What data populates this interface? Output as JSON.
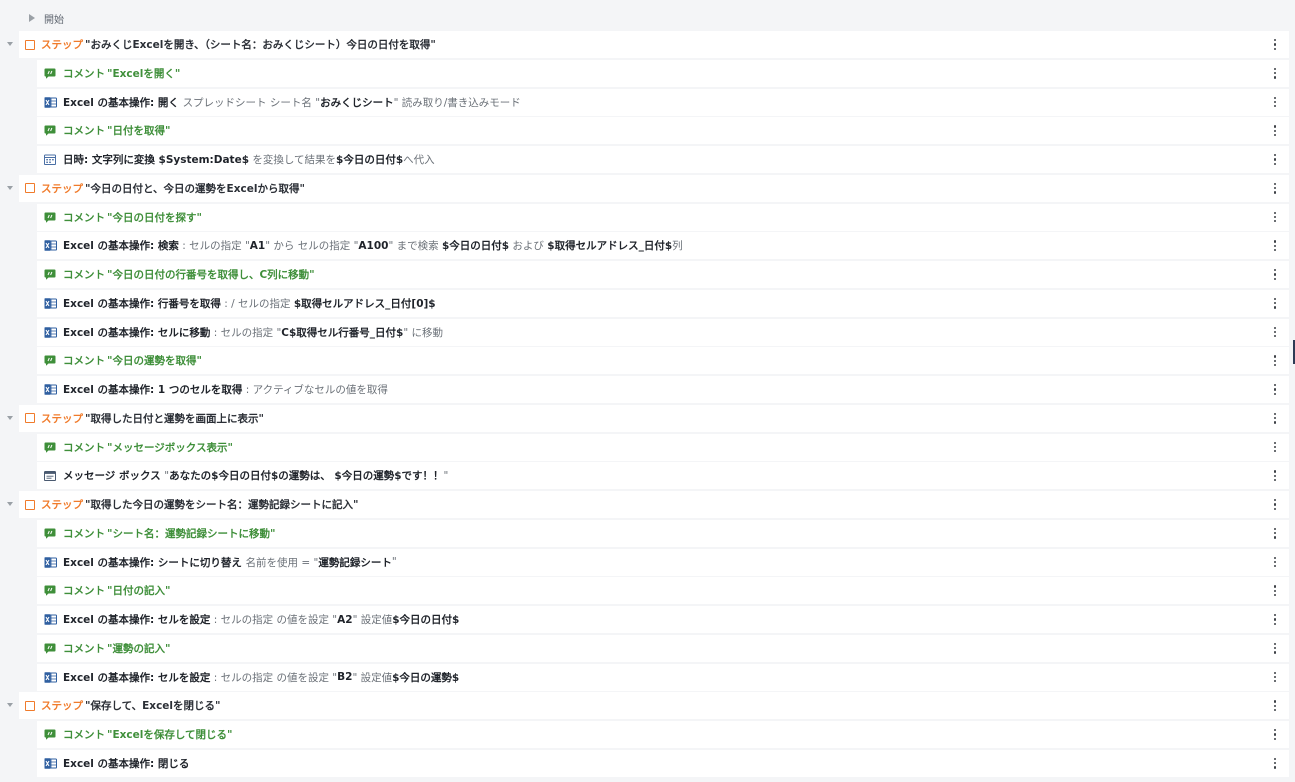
{
  "start_label": "開始",
  "rows": [
    {
      "type": "step",
      "kw": "ステップ",
      "text": "\"おみくじExcelを開き、（シート名：おみくじシート）今日の日付を取得\""
    },
    {
      "type": "comment",
      "kw": "コメント",
      "text": "\"Excelを開く\""
    },
    {
      "type": "excel",
      "parts": [
        [
          "b",
          "Excel の基本操作: 開く "
        ],
        [
          "m",
          "スプレッドシート シート名 \""
        ],
        [
          "s",
          "おみくじシート"
        ],
        [
          "m",
          "\" 読み取り/書き込みモード"
        ]
      ]
    },
    {
      "type": "comment",
      "kw": "コメント",
      "text": "\"日付を取得\""
    },
    {
      "type": "datetime",
      "parts": [
        [
          "b",
          "日時: 文字列に変換 "
        ],
        [
          "s",
          "$System:Date$"
        ],
        [
          "m",
          " を変換して結果を"
        ],
        [
          "s",
          "$今日の日付$"
        ],
        [
          "m",
          "へ代入"
        ]
      ]
    },
    {
      "type": "step",
      "kw": "ステップ",
      "text": "\"今日の日付と、今日の運勢をExcelから取得\""
    },
    {
      "type": "comment",
      "kw": "コメント",
      "text": "\"今日の日付を探す\""
    },
    {
      "type": "excel",
      "parts": [
        [
          "b",
          "Excel の基本操作: 検索"
        ],
        [
          "m",
          " : セルの指定 \""
        ],
        [
          "s",
          "A1"
        ],
        [
          "m",
          "\" から セルの指定 \""
        ],
        [
          "s",
          "A100"
        ],
        [
          "m",
          "\" まで検索 "
        ],
        [
          "s",
          "$今日の日付$"
        ],
        [
          "m",
          " および "
        ],
        [
          "s",
          "$取得セルアドレス_日付$"
        ],
        [
          "m",
          "列"
        ]
      ]
    },
    {
      "type": "comment",
      "kw": "コメント",
      "text": "\"今日の日付の行番号を取得し、C列に移動\""
    },
    {
      "type": "excel",
      "parts": [
        [
          "b",
          "Excel の基本操作: 行番号を取得"
        ],
        [
          "m",
          " : / セルの指定 "
        ],
        [
          "s",
          "$取得セルアドレス_日付[0]$"
        ]
      ]
    },
    {
      "type": "excel",
      "parts": [
        [
          "b",
          "Excel の基本操作: セルに移動"
        ],
        [
          "m",
          " : セルの指定 \""
        ],
        [
          "s",
          "C$取得セル行番号_日付$"
        ],
        [
          "m",
          "\" に移動"
        ]
      ]
    },
    {
      "type": "comment",
      "kw": "コメント",
      "text": "\"今日の運勢を取得\""
    },
    {
      "type": "excel",
      "parts": [
        [
          "b",
          "Excel の基本操作: 1 つのセルを取得"
        ],
        [
          "m",
          " : アクティブなセルの値を取得"
        ]
      ]
    },
    {
      "type": "step",
      "kw": "ステップ",
      "text": "\"取得した日付と運勢を画面上に表示\""
    },
    {
      "type": "comment",
      "kw": "コメント",
      "text": "\"メッセージボックス表示\""
    },
    {
      "type": "msgbox",
      "parts": [
        [
          "b",
          "メッセージ ボックス "
        ],
        [
          "m",
          "\""
        ],
        [
          "s",
          "あなたの$今日の日付$の運勢は、 $今日の運勢$です！！"
        ],
        [
          "m",
          "\""
        ]
      ]
    },
    {
      "type": "step",
      "kw": "ステップ",
      "text": "\"取得した今日の運勢をシート名：運勢記録シートに記入\""
    },
    {
      "type": "comment",
      "kw": "コメント",
      "text": "\"シート名：運勢記録シートに移動\""
    },
    {
      "type": "excel",
      "parts": [
        [
          "b",
          "Excel の基本操作: シートに切り替え "
        ],
        [
          "m",
          "名前を使用 = \""
        ],
        [
          "s",
          "運勢記録シート"
        ],
        [
          "m",
          "\""
        ]
      ]
    },
    {
      "type": "comment",
      "kw": "コメント",
      "text": "\"日付の記入\""
    },
    {
      "type": "excel",
      "parts": [
        [
          "b",
          "Excel の基本操作: セルを設定"
        ],
        [
          "m",
          " : セルの指定 の値を設定 \""
        ],
        [
          "s",
          "A2"
        ],
        [
          "m",
          "\" 設定値"
        ],
        [
          "s",
          "$今日の日付$"
        ]
      ]
    },
    {
      "type": "comment",
      "kw": "コメント",
      "text": "\"運勢の記入\""
    },
    {
      "type": "excel",
      "parts": [
        [
          "b",
          "Excel の基本操作: セルを設定"
        ],
        [
          "m",
          " : セルの指定 の値を設定 \""
        ],
        [
          "s",
          "B2"
        ],
        [
          "m",
          "\" 設定値"
        ],
        [
          "s",
          "$今日の運勢$"
        ]
      ]
    },
    {
      "type": "step",
      "kw": "ステップ",
      "text": "\"保存して、Excelを閉じる\""
    },
    {
      "type": "comment",
      "kw": "コメント",
      "text": "\"Excelを保存して閉じる\""
    },
    {
      "type": "excel",
      "parts": [
        [
          "b",
          "Excel の基本操作: 閉じる"
        ]
      ]
    }
  ],
  "colors": {
    "step": "#f07b2b",
    "comment": "#3f8f3a",
    "excel_icon": "#2f5fa0"
  },
  "icons": {
    "step": "step-checkbox-icon",
    "comment": "comment-icon",
    "excel": "excel-icon",
    "datetime": "calendar-icon",
    "msgbox": "message-box-icon",
    "menu": "more-vertical-icon"
  }
}
